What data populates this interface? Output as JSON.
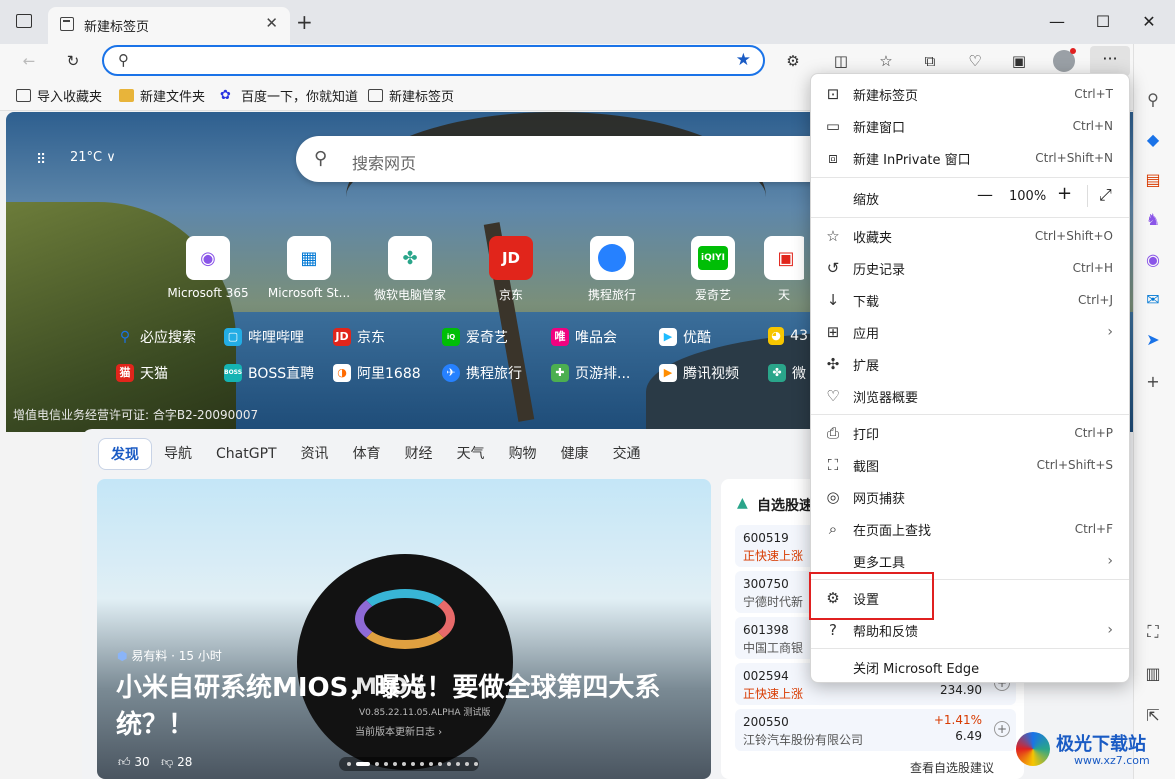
{
  "tab": {
    "title": "新建标签页",
    "close": "✕",
    "new": "+"
  },
  "window": {
    "min": "—",
    "max": "☐",
    "close": "✕"
  },
  "bookmarks": [
    {
      "label": "导入收藏夹"
    },
    {
      "label": "新建文件夹"
    },
    {
      "label": "百度一下，你就知道"
    },
    {
      "label": "新建标签页"
    }
  ],
  "page": {
    "weather": "21°C ∨",
    "search_placeholder": "搜索网页",
    "tiles": [
      "Microsoft 365",
      "Microsoft St...",
      "微软电脑管家",
      "京东",
      "携程旅行",
      "爱奇艺",
      "天"
    ],
    "quicklinks_row1": [
      "必应搜索",
      "哔哩哔哩",
      "京东",
      "爱奇艺",
      "唯品会",
      "优酷",
      "43"
    ],
    "quicklinks_row2": [
      "天猫",
      "BOSS直聘",
      "阿里1688",
      "携程旅行",
      "页游排...",
      "腾讯视频",
      "微"
    ],
    "license": "增值电信业务经营许可证: 合字B2-20090007"
  },
  "feed": {
    "nav": [
      "发现",
      "导航",
      "ChatGPT",
      "资讯",
      "体育",
      "财经",
      "天气",
      "购物",
      "健康",
      "交通"
    ],
    "news": {
      "source": "易有料 · 15 小时",
      "title": "小米自研系统MIOS，曝光！要做全球第四大系统？！",
      "likes": "30",
      "dislikes": "28",
      "mios": "MIOS",
      "version": "V0.85.22.11.05.ALPHA 测试版",
      "notes": "当前版本更新日志 ›"
    },
    "stocks": {
      "title": "自选股速",
      "rows": [
        {
          "code": "600519",
          "name": "正快速上涨",
          "pct": "",
          "price": ""
        },
        {
          "code": "300750",
          "name": "宁德时代新",
          "pct": "",
          "price": ""
        },
        {
          "code": "601398",
          "name": "中国工商银",
          "pct": "",
          "price": ""
        },
        {
          "code": "002594",
          "name": "正快速上涨",
          "pct": "",
          "price": "234.90"
        },
        {
          "code": "200550",
          "name": "江铃汽车股份有限公司",
          "pct": "+1.41%",
          "price": "6.49"
        }
      ],
      "more": "查看自选股建议"
    }
  },
  "menu": {
    "items": [
      {
        "label": "新建标签页",
        "shortcut": "Ctrl+T"
      },
      {
        "label": "新建窗口",
        "shortcut": "Ctrl+N"
      },
      {
        "label": "新建 InPrivate 窗口",
        "shortcut": "Ctrl+Shift+N"
      },
      {
        "label": "缩放",
        "zoom": "100%"
      },
      {
        "label": "收藏夹",
        "shortcut": "Ctrl+Shift+O"
      },
      {
        "label": "历史记录",
        "shortcut": "Ctrl+H"
      },
      {
        "label": "下载",
        "shortcut": "Ctrl+J"
      },
      {
        "label": "应用",
        "shortcut": ""
      },
      {
        "label": "扩展",
        "shortcut": ""
      },
      {
        "label": "浏览器概要",
        "shortcut": ""
      },
      {
        "label": "打印",
        "shortcut": "Ctrl+P"
      },
      {
        "label": "截图",
        "shortcut": "Ctrl+Shift+S"
      },
      {
        "label": "网页捕获",
        "shortcut": ""
      },
      {
        "label": "在页面上查找",
        "shortcut": "Ctrl+F"
      },
      {
        "label": "更多工具",
        "shortcut": ""
      },
      {
        "label": "设置",
        "shortcut": ""
      },
      {
        "label": "帮助和反馈",
        "shortcut": ""
      },
      {
        "label": "关闭 Microsoft Edge",
        "shortcut": ""
      }
    ]
  },
  "watermark": {
    "line1": "极光下载站",
    "line2": "www.xz7.com"
  },
  "colors": {
    "accent": "#1a73e8",
    "highlight": "#e02020",
    "up": "#d83b01"
  }
}
